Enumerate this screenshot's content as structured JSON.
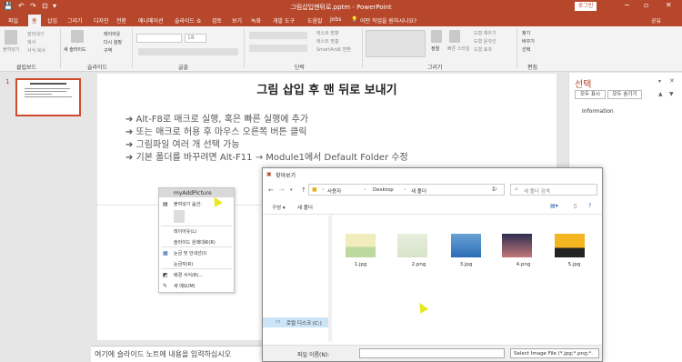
{
  "window": {
    "title": "그림삽입맨뒤로.pptm - PowerPoint",
    "login_label": "로그인",
    "min": "−",
    "restore": "▫",
    "close": "✕"
  },
  "quick_access": {
    "save": "💾",
    "undo": "↶",
    "redo": "↷",
    "present": "⊡",
    "more": "▾"
  },
  "tabs": [
    "파일",
    "홈",
    "삽입",
    "그리기",
    "디자인",
    "전환",
    "애니메이션",
    "슬라이드 쇼",
    "검토",
    "보기",
    "녹화",
    "개발 도구",
    "도움말",
    "Jobs",
    "어떤 작업을 원하시나요?",
    "공유"
  ],
  "ribbon": {
    "groups": [
      "클립보드",
      "슬라이드",
      "글꼴",
      "단락",
      "그리기",
      "편집"
    ],
    "clipboard": {
      "paste": "붙여넣기",
      "cut": "잘라내기",
      "copy": "복사",
      "format_painter": "서식 복사"
    },
    "slides": {
      "new_slide": "새 슬라이드",
      "layout": "레이아웃",
      "reset": "다시 설정",
      "section": "구역"
    },
    "font": {
      "size": "18"
    },
    "paragraph": {
      "text_direction": "텍스트 방향",
      "align_text": "텍스트 맞춤",
      "smartart": "SmartArt로 변환"
    },
    "drawing": {
      "arrange": "정렬",
      "quick_styles": "빠른 스타일",
      "shape_fill": "도형 채우기",
      "shape_outline": "도형 윤곽선",
      "shape_effects": "도형 효과"
    },
    "editing": {
      "find": "찾기",
      "replace": "바꾸기",
      "select": "선택"
    }
  },
  "slide_number": "1",
  "slide": {
    "title": "그림 삽입 후 맨 뒤로 보내기",
    "bullets": [
      "➔ Alt-F8로 매크로 실행, 혹은 빠른 실행에 추가",
      "➔ 또는 매크로 허용 후 마우스 오른쪽 버튼 클릭",
      "➔ 그림파일 여러 개 선택 가능",
      "➔ 기본 폴더를 바꾸려면 Alt-F11 → Module1에서 Default Folder 수정"
    ]
  },
  "notes_placeholder": "여기에 슬라이드 노트에 내용을 입력하십시오",
  "selection_pane": {
    "title": "선택",
    "show_all": "모두 표시",
    "hide_all": "모두 숨기기",
    "item": "Information",
    "up": "▲",
    "down": "▼"
  },
  "context_menu": {
    "header": "myAddPicture",
    "items": [
      "붙여넣기 옵션:",
      "레이아웃(L)",
      "슬라이드 원래대로(R)",
      "눈금 및 안내선(I)",
      "눈금자(R)",
      "배경 서식(B)...",
      "새 메모(M)"
    ]
  },
  "dialog": {
    "title": "찾아보기",
    "path": [
      "사용자",
      "Desktop",
      "새 폴더"
    ],
    "search_placeholder": "새 폴더 검색",
    "organize": "구성 ▾",
    "new_folder": "새 폴더",
    "sidebar_item": "로컬 디스크 (C:)",
    "filename_label": "파일 이름(N):",
    "filetype": "Select Image File (*.jpg;*.png;*.",
    "files": [
      {
        "name": "1.jpg",
        "colors": [
          "#f1ecbb",
          "#bdd9a0"
        ]
      },
      {
        "name": "2.png",
        "colors": [
          "#e7eedd",
          "#d6e3c9"
        ]
      },
      {
        "name": "3.jpg",
        "colors": [
          "#6aa1d4",
          "#2a6db5"
        ]
      },
      {
        "name": "4.png",
        "colors": [
          "#2d2e4e",
          "#c3787a"
        ]
      },
      {
        "name": "5.jpg",
        "colors": [
          "#f3b520",
          "#232323"
        ]
      }
    ]
  },
  "colors": {
    "accent": "#b7472a",
    "selection": "#d04a2c"
  }
}
